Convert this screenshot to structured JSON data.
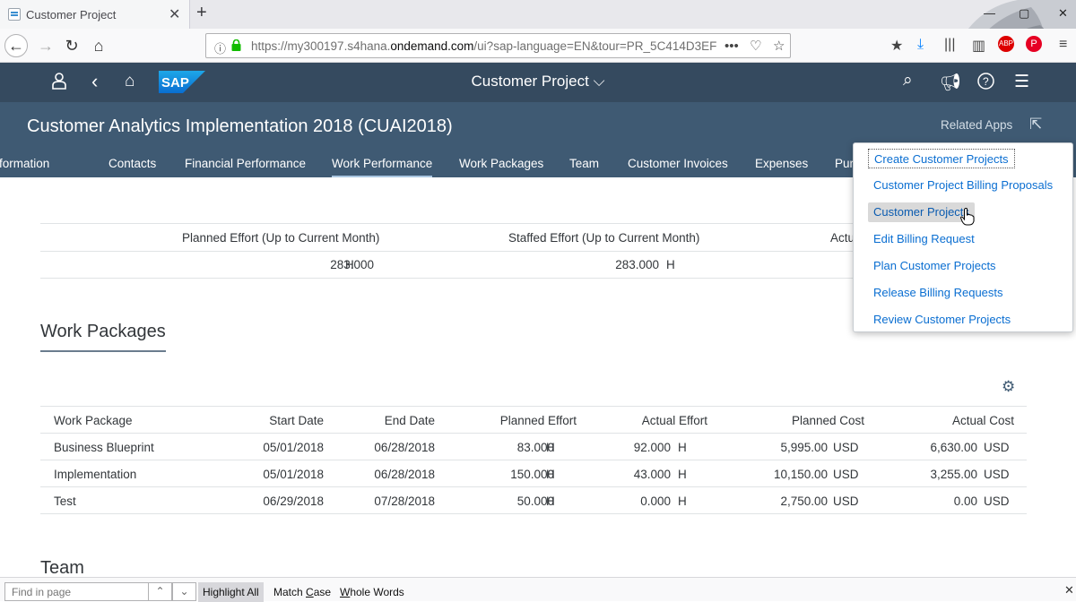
{
  "browser": {
    "tab_title": "Customer Project",
    "tab_close": "✕",
    "new_tab": "+",
    "url_prefix": "https://my300197.s4hana.",
    "url_domain": "ondemand.com",
    "url_suffix": "/ui?sap-language=EN&tour=PR_5C414D3EF",
    "page_actions": "•••",
    "min": "—",
    "max": "▢",
    "close": "✕"
  },
  "shell": {
    "title": "Customer Project",
    "logo_text": "SAP"
  },
  "header": {
    "object_title": "Customer Analytics Implementation 2018 (CUAI2018)",
    "related_apps": "Related Apps",
    "tabs": [
      "formation",
      "Contacts",
      "Financial Performance",
      "Work Performance",
      "Work Packages",
      "Team",
      "Customer Invoices",
      "Expenses",
      "Pur"
    ],
    "selected_tab": "Work Performance"
  },
  "kpi": {
    "headers": [
      "Planned Effort (Up to Current Month)",
      "Staffed Effort (Up to Current Month)",
      "Actu"
    ],
    "values": [
      "283.000",
      "283.000"
    ],
    "unit": "H"
  },
  "work_packages": {
    "section_title": "Work Packages",
    "columns": [
      "Work Package",
      "Start Date",
      "End Date",
      "Planned Effort",
      "Actual Effort",
      "Planned Cost",
      "Actual Cost"
    ],
    "rows": [
      {
        "name": "Business Blueprint",
        "start": "05/01/2018",
        "end": "06/28/2018",
        "planned_effort": "83.000",
        "pe_unit": "H",
        "actual_effort": "92.000",
        "ae_unit": "H",
        "planned_cost": "5,995.00",
        "pc_cur": "USD",
        "actual_cost": "6,630.00",
        "ac_cur": "USD"
      },
      {
        "name": "Implementation",
        "start": "05/01/2018",
        "end": "06/28/2018",
        "planned_effort": "150.000",
        "pe_unit": "H",
        "actual_effort": "43.000",
        "ae_unit": "H",
        "planned_cost": "10,150.00",
        "pc_cur": "USD",
        "actual_cost": "3,255.00",
        "ac_cur": "USD"
      },
      {
        "name": "Test",
        "start": "06/29/2018",
        "end": "07/28/2018",
        "planned_effort": "50.000",
        "pe_unit": "H",
        "actual_effort": "0.000",
        "ae_unit": "H",
        "planned_cost": "2,750.00",
        "pc_cur": "USD",
        "actual_cost": "0.00",
        "ac_cur": "USD"
      }
    ]
  },
  "team": {
    "section_title": "Team"
  },
  "related_apps_menu": {
    "items": [
      "Create Customer Projects",
      "Customer Project Billing Proposals",
      "Customer Projects",
      "Edit Billing Request",
      "Plan Customer Projects",
      "Release Billing Requests",
      "Review Customer Projects"
    ],
    "hovered": "Customer Projects"
  },
  "findbar": {
    "placeholder": "Find in page",
    "highlight_all": "Highlight All",
    "match_case_pre": "Match ",
    "match_case_u": "C",
    "match_case_post": "ase",
    "whole_words_u": "W",
    "whole_words_post": "hole Words"
  },
  "colors": {
    "shell_bg": "#354a5f",
    "header_bg": "#3f5a73",
    "link": "#0a6ed1"
  }
}
